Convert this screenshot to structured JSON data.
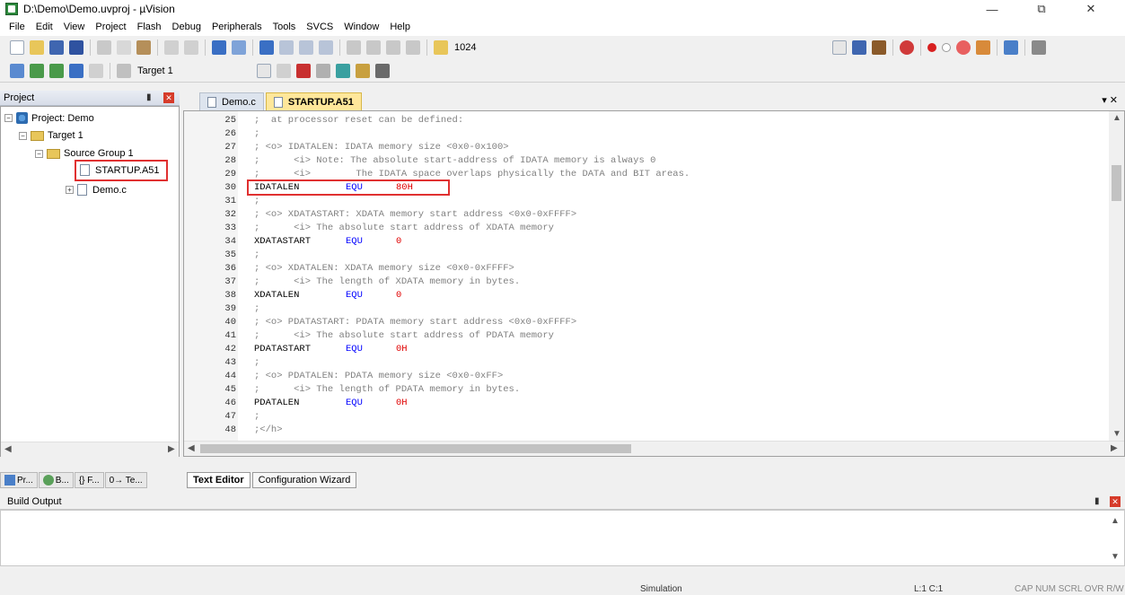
{
  "window": {
    "title": "D:\\Demo\\Demo.uvproj - µVision",
    "minimize": "—",
    "maximize": "⧉",
    "close": "✕"
  },
  "menu": [
    "File",
    "Edit",
    "View",
    "Project",
    "Flash",
    "Debug",
    "Peripherals",
    "Tools",
    "SVCS",
    "Window",
    "Help"
  ],
  "toolbar": {
    "find_value": "1024",
    "target": "Target 1"
  },
  "project_panel": {
    "title": "Project",
    "tree": {
      "root": "Project: Demo",
      "target": "Target 1",
      "group": "Source Group 1",
      "file1": "STARTUP.A51",
      "file2": "Demo.c"
    },
    "bottom_tabs": [
      "Pr...",
      "B...",
      "{} F...",
      "0→ Te..."
    ]
  },
  "editor": {
    "tabs": [
      "Demo.c",
      "STARTUP.A51"
    ],
    "lines": [
      {
        "n": "25",
        "comment": ";  at processor reset can be defined:"
      },
      {
        "n": "26",
        "comment": ";"
      },
      {
        "n": "27",
        "comment": "; <o> IDATALEN: IDATA memory size <0x0-0x100>"
      },
      {
        "n": "28",
        "comment": ";      <i> Note: The absolute start-address of IDATA memory is always 0"
      },
      {
        "n": "29",
        "comment": ";      <i>        The IDATA space overlaps physically the DATA and BIT areas."
      },
      {
        "n": "30",
        "label": "IDATALEN",
        "kw": "EQU",
        "val": "80H"
      },
      {
        "n": "31",
        "comment": ";"
      },
      {
        "n": "32",
        "comment": "; <o> XDATASTART: XDATA memory start address <0x0-0xFFFF>"
      },
      {
        "n": "33",
        "comment": ";      <i> The absolute start address of XDATA memory"
      },
      {
        "n": "34",
        "label": "XDATASTART",
        "kw": "EQU",
        "val": "0"
      },
      {
        "n": "35",
        "comment": ";"
      },
      {
        "n": "36",
        "comment": "; <o> XDATALEN: XDATA memory size <0x0-0xFFFF>"
      },
      {
        "n": "37",
        "comment": ";      <i> The length of XDATA memory in bytes."
      },
      {
        "n": "38",
        "label": "XDATALEN",
        "kw": "EQU",
        "val": "0"
      },
      {
        "n": "39",
        "comment": ";"
      },
      {
        "n": "40",
        "comment": "; <o> PDATASTART: PDATA memory start address <0x0-0xFFFF>"
      },
      {
        "n": "41",
        "comment": ";      <i> The absolute start address of PDATA memory"
      },
      {
        "n": "42",
        "label": "PDATASTART",
        "kw": "EQU",
        "val": "0H"
      },
      {
        "n": "43",
        "comment": ";"
      },
      {
        "n": "44",
        "comment": "; <o> PDATALEN: PDATA memory size <0x0-0xFF>"
      },
      {
        "n": "45",
        "comment": ";      <i> The length of PDATA memory in bytes."
      },
      {
        "n": "46",
        "label": "PDATALEN",
        "kw": "EQU",
        "val": "0H"
      },
      {
        "n": "47",
        "comment": ";"
      },
      {
        "n": "48",
        "comment": ";</h>"
      }
    ],
    "bottom_tabs": [
      "Text Editor",
      "Configuration Wizard"
    ]
  },
  "build_output": {
    "title": "Build Output"
  },
  "status": {
    "mode": "Simulation",
    "cursor": "L:1 C:1",
    "flags": "CAP  NUM  SCRL  OVR  R/W"
  }
}
